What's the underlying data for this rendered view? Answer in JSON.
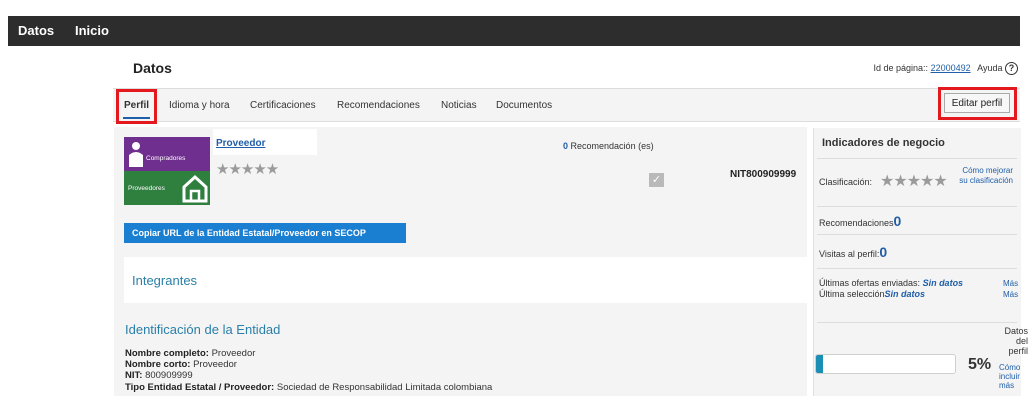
{
  "topnav": {
    "items": [
      "Datos",
      "Inicio"
    ]
  },
  "page": {
    "title": "Datos",
    "page_id_label": "Id de página::",
    "page_id_value": "22000492",
    "help_label": "Ayuda"
  },
  "tabs": [
    "Perfil",
    "Idioma y hora",
    "Certificaciones",
    "Recomendaciones",
    "Noticias",
    "Documentos"
  ],
  "active_tab": "Perfil",
  "edit_button": "Editar perfil",
  "logo": {
    "top_text": "Compradores",
    "bottom_text": "Proveedores",
    "top_color": "#6f2f8e",
    "bottom_color": "#2f7f3f"
  },
  "profile": {
    "name": "Proveedor",
    "rating_stars": "★★★★★",
    "recommendations_count": "0",
    "recommendations_label": "Recomendación (es)",
    "nit": "NIT800909999",
    "copy_url_button": "Copiar URL de la Entidad Estatal/Proveedor en SECOP"
  },
  "sections": {
    "integrantes": "Integrantes",
    "identificacion": "Identificación de la Entidad"
  },
  "fields": [
    {
      "label": "Nombre completo:",
      "value": "Proveedor"
    },
    {
      "label": "Nombre corto:",
      "value": "Proveedor"
    },
    {
      "label": "NIT:",
      "value": "800909999"
    },
    {
      "label": "Tipo Entidad Estatal / Proveedor:",
      "value": "Sociedad de Responsabilidad Limitada colombiana"
    }
  ],
  "indicators": {
    "title": "Indicadores de negocio",
    "classification_label": "Clasificación:",
    "classification_stars": "★★★★★",
    "improve_link": "Cómo mejorar su clasificación",
    "recommendations_label": "Recomendaciones",
    "recommendations_value": "0",
    "visits_label": "Visitas al perfil:",
    "visits_value": "0",
    "last_offers_label": "Últimas ofertas enviadas:",
    "last_offers_value": "Sin datos",
    "last_selection_label": "Última selección",
    "last_selection_value": "Sin datos",
    "more_1": "Más",
    "more_2": "Más",
    "profile_data_label": "Datos del perfil",
    "completion_percent": "5%",
    "completion_value": 0.05,
    "include_more_link": "Cómo incluir más"
  },
  "colors": {
    "accent": "#1f5ea8",
    "button_blue": "#1a7fd1",
    "highlight_red": "#e3191d",
    "topbar": "#2d2d2d"
  }
}
